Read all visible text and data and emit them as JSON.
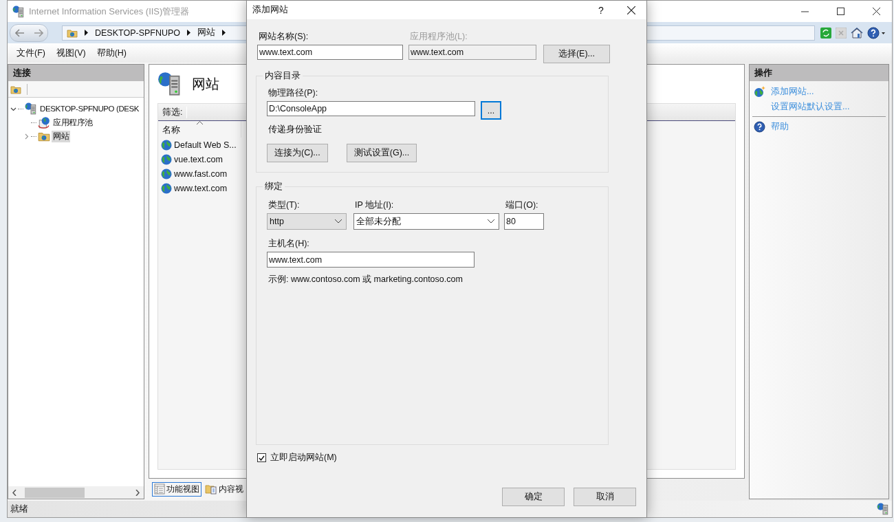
{
  "window": {
    "title": "Internet Information Services (IIS)管理器"
  },
  "breadcrumb": [
    "DESKTOP-SPFNUPO",
    "网站"
  ],
  "menu": [
    "文件(F)",
    "视图(V)",
    "帮助(H)"
  ],
  "connections": {
    "title": "连接",
    "tree": [
      {
        "label": "DESKTOP-SPFNUPO (DESK",
        "kind": "server",
        "expanded": true,
        "selected": false,
        "children": [
          {
            "label": "应用程序池",
            "kind": "pool",
            "selected": false
          },
          {
            "label": "网站",
            "kind": "sites",
            "expanded": false,
            "selected": true
          }
        ]
      }
    ]
  },
  "content": {
    "title": "网站",
    "filter_label": "筛选:",
    "columns": [
      "名称"
    ],
    "rows": [
      "Default Web S...",
      "vue.text.com",
      "www.fast.com",
      "www.text.com"
    ],
    "view_tabs": [
      {
        "label": "功能视图",
        "kind": "features",
        "selected": true
      },
      {
        "label": "内容视",
        "kind": "content",
        "selected": false
      }
    ]
  },
  "actions": {
    "title": "操作",
    "items": [
      {
        "label": "添加网站...",
        "kind": "add-site"
      },
      {
        "label": "设置网站默认设置...",
        "kind": "plain"
      },
      {
        "label": "帮助",
        "kind": "help"
      }
    ]
  },
  "status_bar": "就绪",
  "dialog": {
    "title": "添加网站",
    "help": "?",
    "site_name": {
      "label": "网站名称(S):",
      "value": "www.text.com"
    },
    "app_pool": {
      "label": "应用程序池(L):",
      "value": "www.text.com",
      "disabled": true
    },
    "select_button": "选择(E)...",
    "content_directory": {
      "title": "内容目录",
      "path_label": "物理路径(P):",
      "path_value": "D:\\ConsoleApp",
      "browse_button": {
        "label": "...",
        "focused": true
      },
      "auth_label": "传递身份验证",
      "buttons": [
        "连接为(C)...",
        "测试设置(G)..."
      ]
    },
    "binding": {
      "title": "绑定",
      "type": {
        "label": "类型(T):",
        "value": "http",
        "kind": "dropdown-list"
      },
      "ip": {
        "label": "IP 地址(I):",
        "value": "全部未分配",
        "kind": "combo"
      },
      "port": {
        "label": "端口(O):",
        "value": "80"
      },
      "host": {
        "label": "主机名(H):",
        "value": "www.text.com"
      },
      "example": "示例: www.contoso.com 或 marketing.contoso.com"
    },
    "start_site": {
      "label": "立即启动网站(M)",
      "checked": true
    },
    "buttons": [
      "确定",
      "取消"
    ]
  }
}
